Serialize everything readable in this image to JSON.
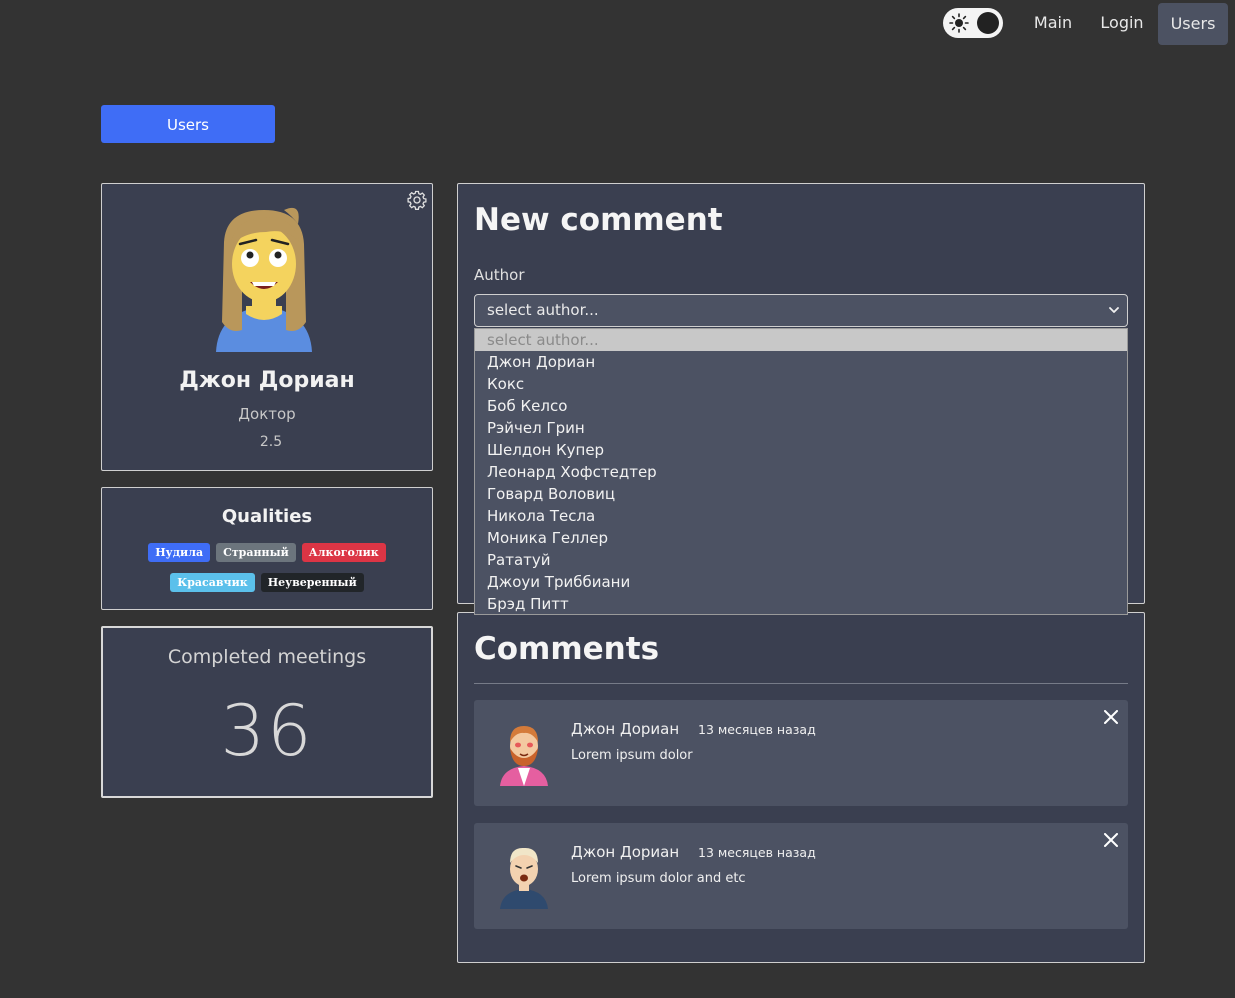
{
  "nav": {
    "main": "Main",
    "login": "Login",
    "users": "Users",
    "theme_toggle": "dark"
  },
  "users_button": "Users",
  "profile": {
    "name": "Джон Дориан",
    "profession": "Доктор",
    "rate": "2.5"
  },
  "qualities": {
    "title": "Qualities",
    "items": [
      {
        "label": "Нудила",
        "color": "#3f6df6"
      },
      {
        "label": "Странный",
        "color": "#6c757d"
      },
      {
        "label": "Алкоголик",
        "color": "#dc3545"
      },
      {
        "label": "Красавчик",
        "color": "#5bc0eb"
      },
      {
        "label": "Неуверенный",
        "color": "#212529"
      }
    ]
  },
  "meetings": {
    "title": "Completed meetings",
    "value": "36"
  },
  "new_comment": {
    "title": "New comment",
    "author_label": "Author",
    "selected": "select author...",
    "options": [
      "select author...",
      "Джон Дориан",
      "Кокс",
      "Боб Келсо",
      "Рэйчел Грин",
      "Шелдон Купер",
      "Леонард Хофстедтер",
      "Говард Воловиц",
      "Никола Тесла",
      "Моника Геллер",
      "Рататуй",
      "Джоуи Триббиани",
      "Брэд Питт"
    ]
  },
  "comments": {
    "title": "Comments",
    "items": [
      {
        "author": "Джон Дориан",
        "time": "13 месяцев назад",
        "text": "Lorem ipsum dolor"
      },
      {
        "author": "Джон Дориан",
        "time": "13 месяцев назад",
        "text": "Lorem ipsum dolor and etc"
      }
    ]
  }
}
